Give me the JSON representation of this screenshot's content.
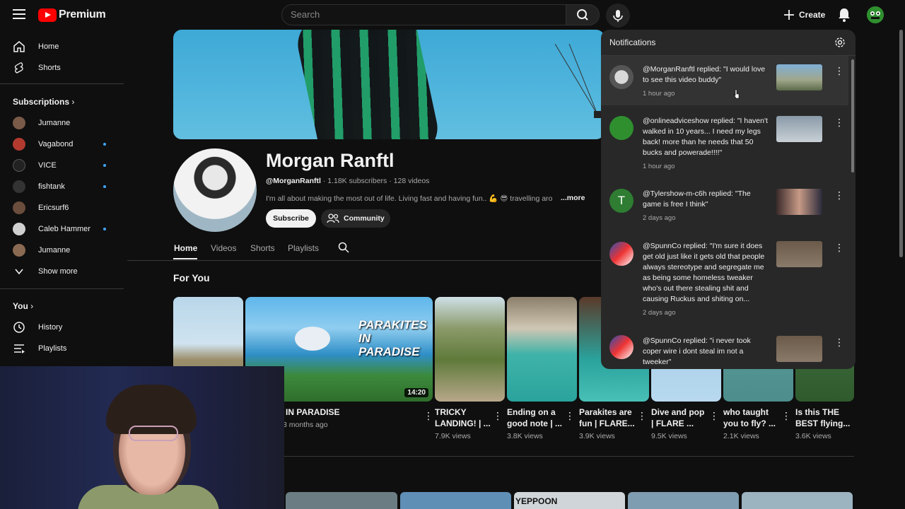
{
  "header": {
    "logo_text": "Premium",
    "search_placeholder": "Search",
    "create_label": "Create"
  },
  "sidebar": {
    "main": [
      {
        "label": "Home",
        "icon": "home-icon"
      },
      {
        "label": "Shorts",
        "icon": "shorts-icon"
      }
    ],
    "subscriptions_title": "Subscriptions",
    "subscriptions": [
      {
        "label": "Jumanne",
        "dot": false,
        "color": "#7a5a48"
      },
      {
        "label": "Vagabond",
        "dot": true,
        "color": "#b23a2f"
      },
      {
        "label": "VICE",
        "dot": true,
        "color": "#222222"
      },
      {
        "label": "fishtank",
        "dot": true,
        "color": "#333333"
      },
      {
        "label": "Ericsurf6",
        "dot": false,
        "color": "#6b4d3d"
      },
      {
        "label": "Caleb Hammer",
        "dot": true,
        "color": "#d0d0d0"
      },
      {
        "label": "Jumanne",
        "dot": false,
        "color": "#8a6a52"
      }
    ],
    "show_more": "Show more",
    "you_title": "You",
    "you_items": [
      {
        "label": "History",
        "icon": "history-icon"
      },
      {
        "label": "Playlists",
        "icon": "playlists-icon"
      }
    ]
  },
  "channel": {
    "name": "Morgan Ranftl",
    "handle": "@MorganRanftl",
    "subscribers": "1.18K subscribers",
    "videos": "128 videos",
    "description": "I'm all about making the most out of life. Living fast and having fun.. 💪 😎 travelling aro",
    "more": "...more",
    "subscribe": "Subscribe",
    "community": "Community",
    "tabs": [
      "Home",
      "Videos",
      "Shorts",
      "Playlists"
    ],
    "section_title": "For You"
  },
  "videos": [
    {
      "title": "",
      "views": "",
      "age": ""
    },
    {
      "title": "IN PARADISE",
      "views": "",
      "age": "3 months ago",
      "duration": "14:20",
      "thumb_text": "PARAKITES IN PARADISE"
    },
    {
      "title": "TRICKY LANDING! | ...",
      "views": "7.9K views"
    },
    {
      "title": "Ending on a good note | ...",
      "views": "3.8K views"
    },
    {
      "title": "Parakites are fun | FLARE...",
      "views": "3.9K views"
    },
    {
      "title": "Dive and pop | FLARE ...",
      "views": "9.5K views"
    },
    {
      "title": "who taught you to fly? ...",
      "views": "2.1K views"
    },
    {
      "title": "Is this THE BEST flying...",
      "views": "3.6K views"
    }
  ],
  "row2_text": "YEPPOON",
  "notifications": {
    "title": "Notifications",
    "items": [
      {
        "text": "@MorganRanftl replied: \"I would love to see this video buddy\"",
        "time": "1 hour ago"
      },
      {
        "text": "@onlineadviceshow replied: \"I haven't walked in 10 years... I need my legs back! more than he needs that 50 bucks and powerade!!!!\"",
        "time": "1 hour ago"
      },
      {
        "text": "@Tylershow-m-c6h replied: \"The game is free I think\"",
        "time": "2 days ago",
        "avatar_letter": "T"
      },
      {
        "text": "@SpunnCo replied: \"I'm sure it does get old just like it gets old that people always stereotype and segregate me as being some homeless tweaker who's out there stealing shit and causing Ruckus and shiting on...",
        "time": "2 days ago"
      },
      {
        "text": "@SpunnCo replied: \"i never took coper wire i dont steal im not a tweeker\"",
        "time": ""
      }
    ]
  },
  "colors": {
    "background": "#0f0f0f",
    "panel": "#282828",
    "accent_red": "#ff0000",
    "dot_blue": "#3ea6ff"
  }
}
